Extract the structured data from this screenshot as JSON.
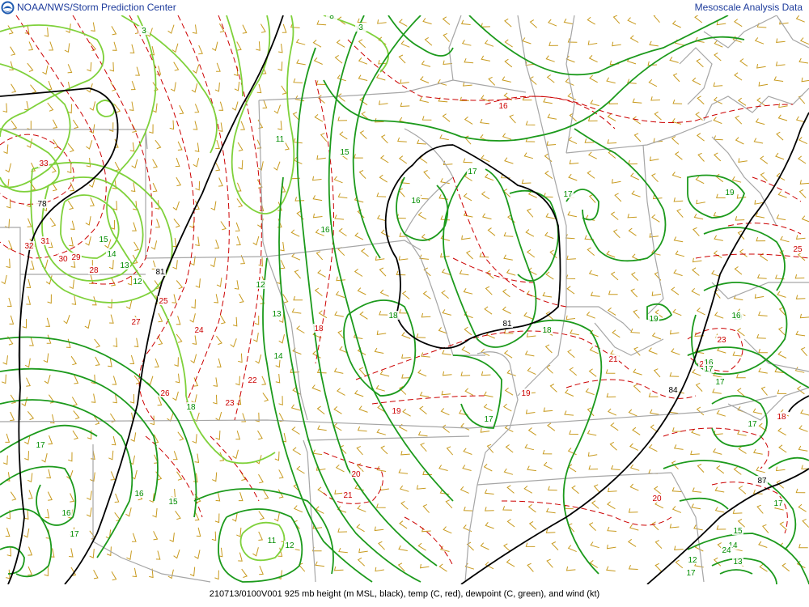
{
  "header": {
    "left_title": "NOAA/NWS/Storm Prediction Center",
    "right_title": "Mesoscale Analysis Data"
  },
  "footer": {
    "caption": "210713/0100V001 925 mb height (m MSL, black), temp (C, red), dewpoint (C, green), and wind (kt)"
  },
  "colors": {
    "height": "#000000",
    "temperature": "#cc0000",
    "dewpoint_dark": "#008c00",
    "dewpoint_light": "#7fd13b",
    "wind_barb": "#c89a1e",
    "borders": "#a0a0a0"
  },
  "labels": {
    "height": [
      "78",
      "81",
      "81",
      "84",
      "87"
    ],
    "temperature": [
      "33",
      "32",
      "31",
      "30",
      "29",
      "28",
      "27",
      "26",
      "25",
      "24",
      "23",
      "22",
      "18",
      "19",
      "19",
      "20",
      "21",
      "20",
      "21",
      "23",
      "22",
      "16",
      "25",
      "18"
    ],
    "dewpoint": [
      "8",
      "3",
      "3",
      "11",
      "15",
      "16",
      "16",
      "15",
      "14",
      "13",
      "12",
      "12",
      "13",
      "14",
      "17",
      "17",
      "18",
      "18",
      "19",
      "19",
      "19",
      "17",
      "17",
      "17",
      "17",
      "16",
      "15",
      "14",
      "13",
      "12",
      "11",
      "12",
      "16",
      "15",
      "16",
      "17",
      "17",
      "17",
      "24",
      "16",
      "17",
      "18"
    ]
  }
}
